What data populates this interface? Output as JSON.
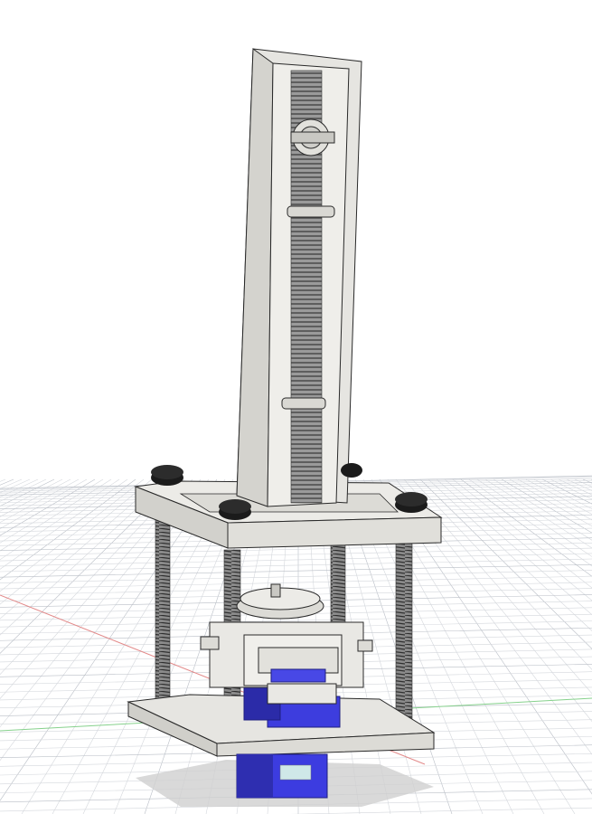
{
  "viewport": {
    "label": ""
  },
  "colors": {
    "background": "#ffffff",
    "grid_line": "#d4d7dc",
    "grid_major": "#b9bec6",
    "x_axis": "#e07b7b",
    "y_axis": "#7fcf86",
    "part_face": "#ededea",
    "part_side": "#d2d1cc",
    "part_edge": "#2a2a2a",
    "rack_teeth": "#6f6f6f",
    "bolt_head": "#1b1b1b",
    "threaded_rod": "#5a5a5a",
    "servo_blue": "#3f3fe0",
    "servo_dark": "#2b2ba8"
  },
  "icons": [
    "socket-head-bolt",
    "pinion-gear",
    "threaded-rod",
    "servo-motor",
    "servo-horn"
  ]
}
